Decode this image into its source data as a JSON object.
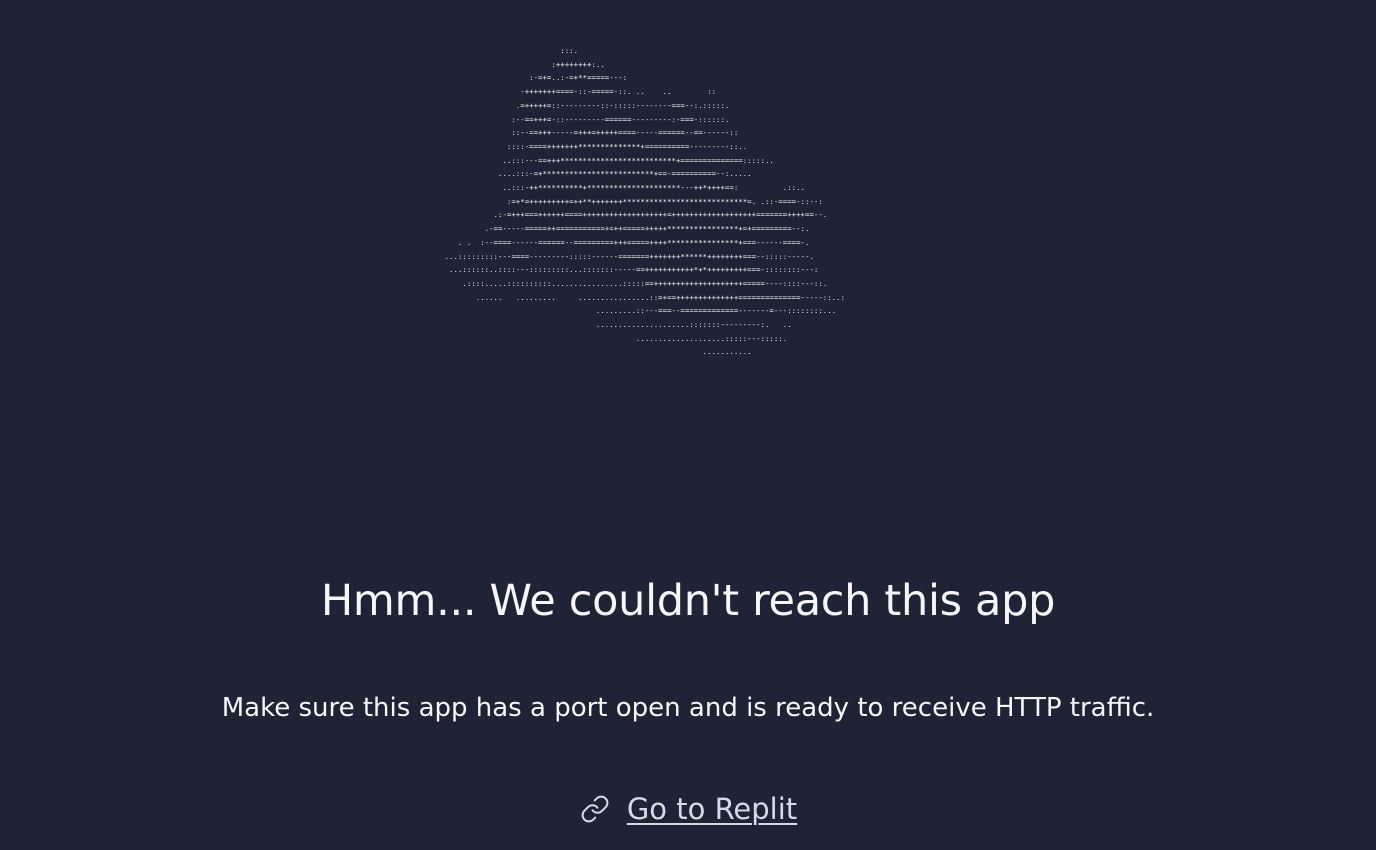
{
  "ascii_art": {
    "lines": [
      "                                  :::.",
      "                                :++++++++:..",
      "                           :-=+=..:-=+**=====---:",
      "                         -+++++++====-::-=====-::. ..    ..        ::",
      "                        .=+++++=::---------::-:::::--------===--:.:::::.",
      "                       :--==+++=-::---------======---------:-===-::::::.",
      "                       ::--==+++-----=+++=+++++====-----======--==------::",
      "                      ::::-====+++++++**************+==========---------::..",
      "                     ..:::---==+++**************************+==============:::::..",
      "                    ....:::-=+*************************+==-==========--:.....",
      "                     ..:::-++**********+*********************---++*++++==:          .::..",
      "                      :=+*=+++++++++=++**+++++++****************************=. .::-====-::--:",
      "                   .:-=+++===++++++====+++++++++++++++++++=+++++++++++++++++++=======++++==--.",
      "                 .-==-----=====++===========+=++=====+++++****************+=+=========--:.",
      "           . .  :--====------======--=========+++=====++++****************+===------====-.",
      "        ...:::::::::---====---------:::::------=======+++++++******++++++++===--:::::-----.",
      "         ...::::::..::::---:::::::::...:::::::-----==+++++++++++*+*+++++++++===-::::::::---:",
      "            .::::.....::::::::::................:::::==++++++++++++++++++++=====----::::---::.",
      "               ......   .........     ................::=+==++++++++++++++==============-----::..:",
      "                                          .........::---===--=============-------=---::::::::...",
      "                                          .....................:::::::---------:.   ..",
      "                                                   ....................:::::---:::::.",
      "                                                                  ..........."
    ]
  },
  "heading": "Hmm... We couldn't reach this app",
  "subtext": "Make sure this app has a port open and is ready to receive HTTP traffic.",
  "link": {
    "icon": "link-icon",
    "label": "Go to Replit"
  },
  "colors": {
    "background": "#1f2335",
    "text": "#f5f7fb",
    "link": "#d5dbe6"
  }
}
